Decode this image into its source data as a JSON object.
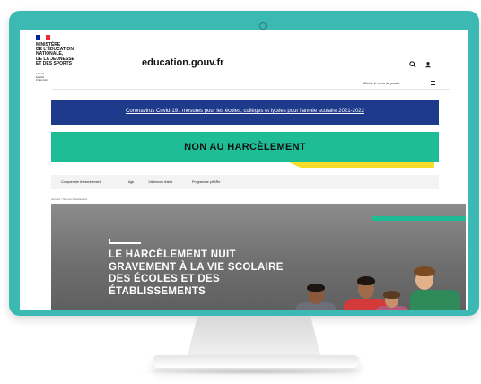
{
  "header": {
    "logo_lines": "MINISTÈRE\nDE L'ÉDUCATION\nNATIONALE,\nDE LA JEUNESSE\nET DES SPORTS",
    "motto": "Liberté\nÉgalité\nFraternité",
    "site_title": "education.gouv.fr",
    "search_icon": "search-icon",
    "connect_icon": "user-icon",
    "menu_label": "Afficher le menu du portail",
    "flag_colors": [
      "#002395",
      "#ffffff",
      "#ed2939"
    ]
  },
  "covid_banner": {
    "text": "Coronavirus Covid-19 : mesures pour les écoles, collèges et lycées pour l'année scolaire 2021-2022"
  },
  "campaign_banner": {
    "text": "NON AU HARCÈLEMENT",
    "color": "#1ebd96",
    "accent": "#f6dc2b"
  },
  "nav": {
    "items": [
      {
        "label": "Comprendre le harcèlement"
      },
      {
        "label": "Agir"
      },
      {
        "label": "J'ai besoin d'aide"
      },
      {
        "label": "Programme pHARe"
      }
    ]
  },
  "breadcrumb": "Accueil  >  Non au harcèlement",
  "hero": {
    "headline": "LE HARCÈLEMENT NUIT GRAVEMENT À LA VIE SCOLAIRE DES ÉCOLES ET DES ÉTABLISSEMENTS"
  },
  "colors": {
    "monitor_frame": "#3bb9b2",
    "covid_banner": "#1e3a8a"
  }
}
